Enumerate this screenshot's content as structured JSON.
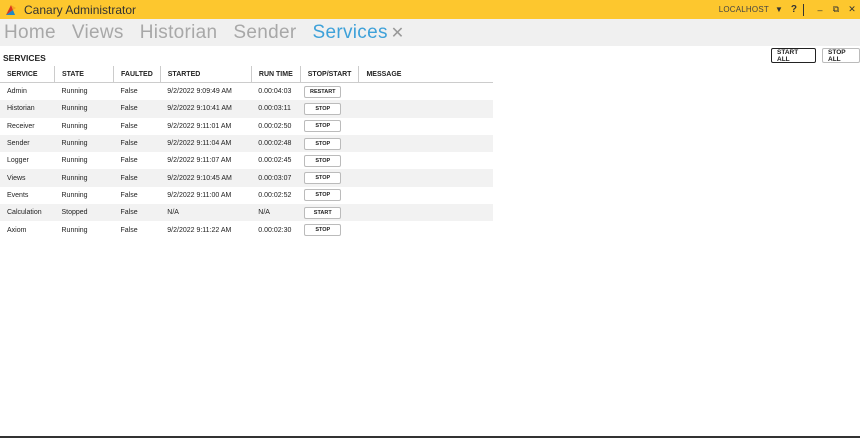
{
  "window": {
    "title": "Canary Administrator",
    "server": "LOCALHOST",
    "help": "?",
    "minimize": "–",
    "restore": "⧉",
    "close": "✕"
  },
  "nav": {
    "tabs": [
      "Home",
      "Views",
      "Historian",
      "Sender",
      "Services"
    ],
    "active": "Services",
    "close_glyph": "✕"
  },
  "services": {
    "title": "SERVICES",
    "start_all_label": "START ALL",
    "stop_all_label": "STOP ALL",
    "columns": [
      "SERVICE",
      "STATE",
      "FAULTED",
      "STARTED",
      "RUN TIME",
      "STOP/START",
      "MESSAGE"
    ],
    "rows": [
      {
        "service": "Admin",
        "state": "Running",
        "faulted": "False",
        "started": "9/2/2022 9:09:49 AM",
        "run_time": "0.00:04:03",
        "action": "RESTART",
        "message": ""
      },
      {
        "service": "Historian",
        "state": "Running",
        "faulted": "False",
        "started": "9/2/2022 9:10:41 AM",
        "run_time": "0.00:03:11",
        "action": "STOP",
        "message": ""
      },
      {
        "service": "Receiver",
        "state": "Running",
        "faulted": "False",
        "started": "9/2/2022 9:11:01 AM",
        "run_time": "0.00:02:50",
        "action": "STOP",
        "message": ""
      },
      {
        "service": "Sender",
        "state": "Running",
        "faulted": "False",
        "started": "9/2/2022 9:11:04 AM",
        "run_time": "0.00:02:48",
        "action": "STOP",
        "message": ""
      },
      {
        "service": "Logger",
        "state": "Running",
        "faulted": "False",
        "started": "9/2/2022 9:11:07 AM",
        "run_time": "0.00:02:45",
        "action": "STOP",
        "message": ""
      },
      {
        "service": "Views",
        "state": "Running",
        "faulted": "False",
        "started": "9/2/2022 9:10:45 AM",
        "run_time": "0.00:03:07",
        "action": "STOP",
        "message": ""
      },
      {
        "service": "Events",
        "state": "Running",
        "faulted": "False",
        "started": "9/2/2022 9:11:00 AM",
        "run_time": "0.00:02:52",
        "action": "STOP",
        "message": ""
      },
      {
        "service": "Calculation",
        "state": "Stopped",
        "faulted": "False",
        "started": "N/A",
        "run_time": "N/A",
        "action": "START",
        "message": ""
      },
      {
        "service": "Axiom",
        "state": "Running",
        "faulted": "False",
        "started": "9/2/2022 9:11:22 AM",
        "run_time": "0.00:02:30",
        "action": "STOP",
        "message": ""
      }
    ]
  },
  "colors": {
    "titlebar": "#fdc72e",
    "active_tab": "#3ea1d9",
    "inactive_tab": "#a8a8a8"
  }
}
